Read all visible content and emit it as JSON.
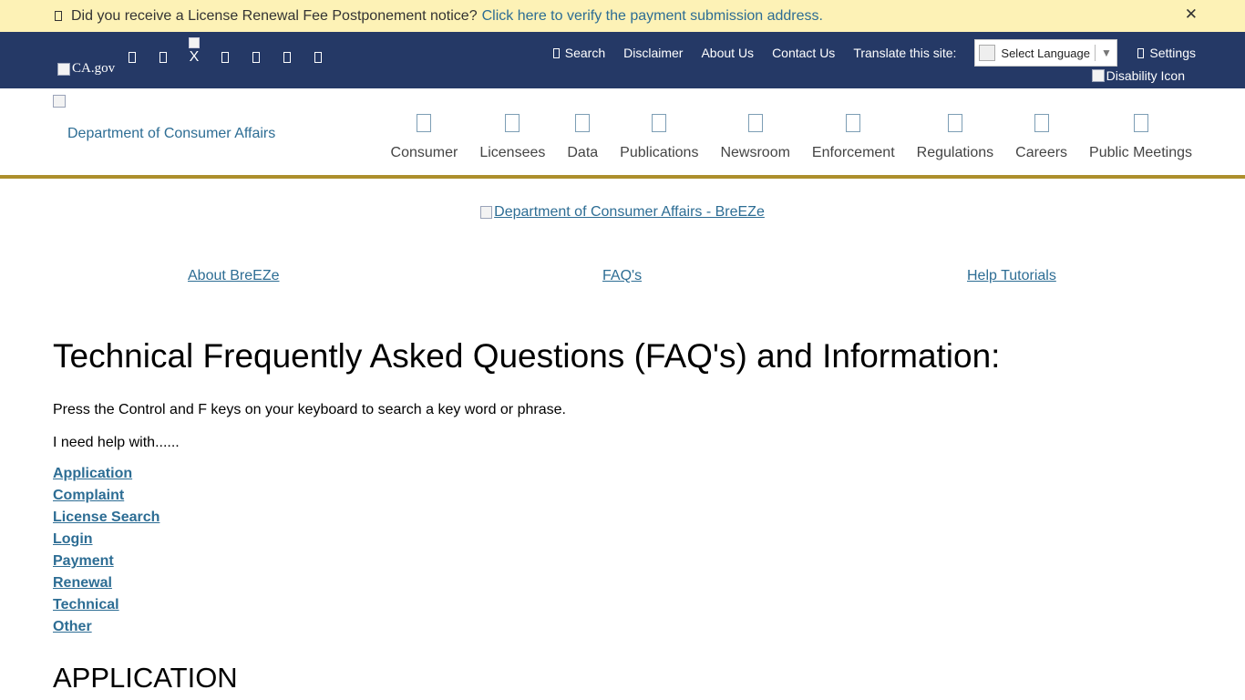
{
  "alert": {
    "message": "Did you receive a License Renewal Fee Postponement notice?",
    "link_text": "Click here to verify the payment submission address.",
    "close_label": "✕"
  },
  "utility": {
    "cagov_alt": "CA.gov",
    "social_x_label": "X",
    "search_label": "Search",
    "disclaimer_label": "Disclaimer",
    "about_label": "About Us",
    "contact_label": "Contact Us",
    "translate_label": "Translate this site:",
    "language_selected": "Select Language",
    "settings_label": "Settings",
    "disability_alt": "Disability Icon"
  },
  "header": {
    "logo_text": "Department of Consumer Affairs",
    "nav": [
      {
        "label": "Consumer"
      },
      {
        "label": "Licensees"
      },
      {
        "label": "Data"
      },
      {
        "label": "Publications"
      },
      {
        "label": "Newsroom"
      },
      {
        "label": "Enforcement"
      },
      {
        "label": "Regulations"
      },
      {
        "label": "Careers"
      },
      {
        "label": "Public Meetings"
      }
    ]
  },
  "main": {
    "breeze_logo_alt": "Department of Consumer Affairs - BreEZe",
    "sublinks": [
      "About BreEZe",
      "FAQ's",
      "Help Tutorials"
    ],
    "title": "Technical Frequently Asked Questions (FAQ's) and Information:",
    "hint": "Press the Control and F keys on your keyboard to search a key word or phrase.",
    "need_help": "I need help with......",
    "help_links": [
      "Application",
      "Complaint",
      "License Search",
      "Login",
      "Payment",
      "Renewal",
      "Technical",
      "Other"
    ],
    "section_heading": "APPLICATION"
  },
  "colors": {
    "alert_bg": "#fdf2b6",
    "utility_bg": "#253966",
    "link": "#2d6d94",
    "header_border": "#ad8f2c"
  }
}
